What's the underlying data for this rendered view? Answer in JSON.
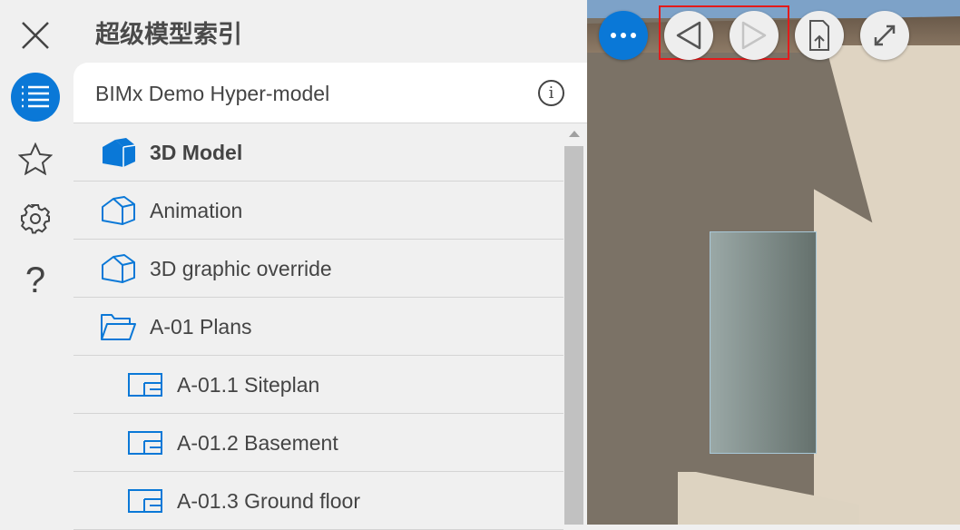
{
  "rail": {
    "close": "close-icon",
    "index": "list-icon",
    "favorites": "star-icon",
    "settings": "gear-icon",
    "help": "?"
  },
  "panel": {
    "title": "超级模型索引",
    "model_name": "BIMx Demo Hyper-model",
    "info": "i"
  },
  "items": [
    {
      "label": "3D Model",
      "icon": "cube-filled-icon",
      "level": 0,
      "active": true
    },
    {
      "label": "Animation",
      "icon": "cube-outline-icon",
      "level": 0
    },
    {
      "label": "3D graphic override",
      "icon": "cube-outline-icon",
      "level": 0
    },
    {
      "label": "A-01 Plans",
      "icon": "folder-open-icon",
      "level": 0
    },
    {
      "label": "A-01.1 Siteplan",
      "icon": "layout-sheet-icon",
      "level": 1
    },
    {
      "label": "A-01.2 Basement",
      "icon": "layout-sheet-icon",
      "level": 1
    },
    {
      "label": "A-01.3 Ground floor",
      "icon": "layout-sheet-icon",
      "level": 1
    }
  ],
  "colors": {
    "accent": "#0a78d7",
    "highlight": "#e31b1b"
  }
}
